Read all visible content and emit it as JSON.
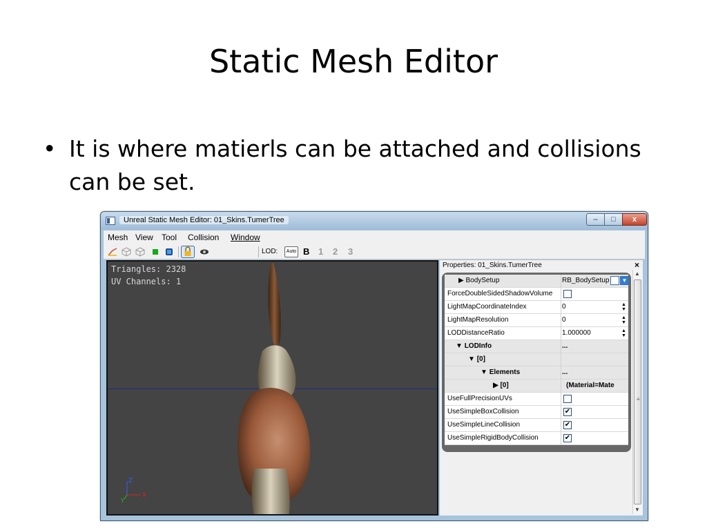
{
  "slide": {
    "title": "Static Mesh Editor",
    "bullet": "It is where matierls can be attached and collisions can be set."
  },
  "window": {
    "title": "Unreal Static Mesh Editor: 01_Skins.TumerTree",
    "buttons": {
      "minimize": "–",
      "maximize": "□",
      "close": "x"
    }
  },
  "menubar": {
    "items": [
      "Mesh",
      "View",
      "Tool",
      "Collision",
      "Window"
    ]
  },
  "toolbar": {
    "lod_label": "LOD:",
    "lod_auto": "Auto",
    "lod_levels": [
      "B",
      "1",
      "2",
      "3"
    ],
    "icons": [
      "wireframe-icon",
      "bounds-icon",
      "collision-icon",
      "solid-green-icon",
      "solid-blue-icon",
      "lock-icon",
      "eye-icon"
    ]
  },
  "viewport": {
    "triangles": "Triangles:  2328",
    "uv_channels": "UV Channels:  1",
    "axis_z": "Z",
    "axis_x": "X",
    "axis_y": "Y"
  },
  "properties": {
    "caption": "Properties: 01_Skins.TumerTree",
    "close": "×",
    "rows": [
      {
        "name": "BodySetup",
        "value": "RB_BodySetup",
        "type": "group-collapsed"
      },
      {
        "name": "ForceDoubleSidedShadowVolume",
        "value": "",
        "type": "check",
        "checked": false
      },
      {
        "name": "LightMapCoordinateIndex",
        "value": "0",
        "type": "spin"
      },
      {
        "name": "LightMapResolution",
        "value": "0",
        "type": "spin"
      },
      {
        "name": "LODDistanceRatio",
        "value": "1.000000",
        "type": "spin"
      },
      {
        "name": "LODInfo",
        "value": "...",
        "type": "group"
      },
      {
        "name": "[0]",
        "value": "",
        "type": "group"
      },
      {
        "name": "Elements",
        "value": "...",
        "type": "group"
      },
      {
        "name": "[0]",
        "value": "(Material=Mate",
        "type": "group-collapsed"
      },
      {
        "name": "UseFullPrecisionUVs",
        "value": "",
        "type": "check",
        "checked": false
      },
      {
        "name": "UseSimpleBoxCollision",
        "value": "✔",
        "type": "check",
        "checked": true
      },
      {
        "name": "UseSimpleLineCollision",
        "value": "✔",
        "type": "check",
        "checked": true
      },
      {
        "name": "UseSimpleRigidBodyCollision",
        "value": "✔",
        "type": "check",
        "checked": true
      }
    ]
  },
  "colors": {
    "viewport_bg": "#444444",
    "horizon": "#1f2f80",
    "titlebar": "#a8c4dd",
    "close_button": "#c4442a"
  }
}
